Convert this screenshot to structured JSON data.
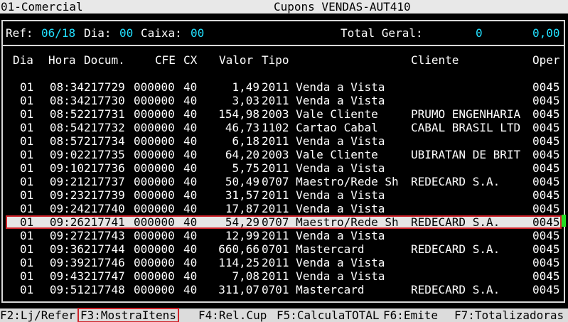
{
  "titlebar": {
    "left": "01-Comercial",
    "center": "Cupons VENDAS-AUT410"
  },
  "header": {
    "ref_label": "Ref:",
    "ref_value": "06/18",
    "dia_label": "Dia:",
    "dia_value": "00",
    "caixa_label": "Caixa:",
    "caixa_value": "00",
    "total_label": "Total Geral:",
    "total_count": "0",
    "total_value": "0,00"
  },
  "columns": {
    "dia": "Dia",
    "hora": "Hora",
    "docum": "Docum.",
    "cfe": "CFE",
    "cx": "CX",
    "valor": "Valor",
    "tipo": "Tipo",
    "cliente": "Cliente",
    "oper": "Oper"
  },
  "rows": [
    {
      "dia": "01",
      "hora": "08:34",
      "doc": "217729",
      "cfe": "000000",
      "cx": "40",
      "valor": "1,49",
      "tipo": "2011 Venda a Vista",
      "cliente": "",
      "oper": "0045"
    },
    {
      "dia": "01",
      "hora": "08:34",
      "doc": "217730",
      "cfe": "000000",
      "cx": "40",
      "valor": "3,03",
      "tipo": "2011 Venda a Vista",
      "cliente": "",
      "oper": "0045"
    },
    {
      "dia": "01",
      "hora": "08:52",
      "doc": "217731",
      "cfe": "000000",
      "cx": "40",
      "valor": "154,98",
      "tipo": "2003 Vale Cliente",
      "cliente": "PRUMO ENGENHARIA",
      "oper": "0045"
    },
    {
      "dia": "01",
      "hora": "08:54",
      "doc": "217732",
      "cfe": "000000",
      "cx": "40",
      "valor": "46,73",
      "tipo": "1102 Cartao Cabal",
      "cliente": "CABAL BRASIL LTD",
      "oper": "0045"
    },
    {
      "dia": "01",
      "hora": "08:57",
      "doc": "217734",
      "cfe": "000000",
      "cx": "40",
      "valor": "6,18",
      "tipo": "2011 Venda a Vista",
      "cliente": "",
      "oper": "0045"
    },
    {
      "dia": "01",
      "hora": "09:02",
      "doc": "217735",
      "cfe": "000000",
      "cx": "40",
      "valor": "64,20",
      "tipo": "2003 Vale Cliente",
      "cliente": "UBIRATAN DE BRIT",
      "oper": "0045"
    },
    {
      "dia": "01",
      "hora": "09:10",
      "doc": "217736",
      "cfe": "000000",
      "cx": "40",
      "valor": "5,75",
      "tipo": "2011 Venda a Vista",
      "cliente": "",
      "oper": "0045"
    },
    {
      "dia": "01",
      "hora": "09:21",
      "doc": "217737",
      "cfe": "000000",
      "cx": "40",
      "valor": "50,49",
      "tipo": "0707 Maestro/Rede Sh",
      "cliente": "REDECARD S.A.",
      "oper": "0045"
    },
    {
      "dia": "01",
      "hora": "09:23",
      "doc": "217739",
      "cfe": "000000",
      "cx": "40",
      "valor": "31,57",
      "tipo": "2011 Venda a Vista",
      "cliente": "",
      "oper": "0045"
    },
    {
      "dia": "01",
      "hora": "09:24",
      "doc": "217740",
      "cfe": "000000",
      "cx": "40",
      "valor": "17,87",
      "tipo": "2011 Venda a Vista",
      "cliente": "",
      "oper": "0045"
    },
    {
      "dia": "01",
      "hora": "09:26",
      "doc": "217741",
      "cfe": "000000",
      "cx": "40",
      "valor": "54,29",
      "tipo": "0707 Maestro/Rede Sh",
      "cliente": "REDECARD S.A.",
      "oper": "0045"
    },
    {
      "dia": "01",
      "hora": "09:27",
      "doc": "217743",
      "cfe": "000000",
      "cx": "40",
      "valor": "12,99",
      "tipo": "2011 Venda a Vista",
      "cliente": "",
      "oper": "0045"
    },
    {
      "dia": "01",
      "hora": "09:36",
      "doc": "217744",
      "cfe": "000000",
      "cx": "40",
      "valor": "660,66",
      "tipo": "0701 Mastercard",
      "cliente": "REDECARD S.A.",
      "oper": "0045"
    },
    {
      "dia": "01",
      "hora": "09:39",
      "doc": "217746",
      "cfe": "000000",
      "cx": "40",
      "valor": "114,25",
      "tipo": "2011 Venda a Vista",
      "cliente": "",
      "oper": "0045"
    },
    {
      "dia": "01",
      "hora": "09:43",
      "doc": "217747",
      "cfe": "000000",
      "cx": "40",
      "valor": "7,08",
      "tipo": "2011 Venda a Vista",
      "cliente": "",
      "oper": "0045"
    },
    {
      "dia": "01",
      "hora": "09:51",
      "doc": "217748",
      "cfe": "000000",
      "cx": "40",
      "valor": "311,07",
      "tipo": "0701 Mastercard",
      "cliente": "REDECARD S.A.",
      "oper": "0045"
    }
  ],
  "selected_row_index": 10,
  "fkeys": {
    "f2": "F2:Lj/Refer",
    "f3": "F3:MostraItens",
    "f4": "F4:Rel.Cup",
    "f5": "F5:CalculaTOTAL",
    "f6": "F6:Emite",
    "f7": "F7:Totalizadoras"
  },
  "colors": {
    "background": "#000000",
    "text": "#ffffff",
    "accent_value": "#22e0ff",
    "selection_bg": "#e6e6e6",
    "highlight_border": "#d0242b"
  }
}
